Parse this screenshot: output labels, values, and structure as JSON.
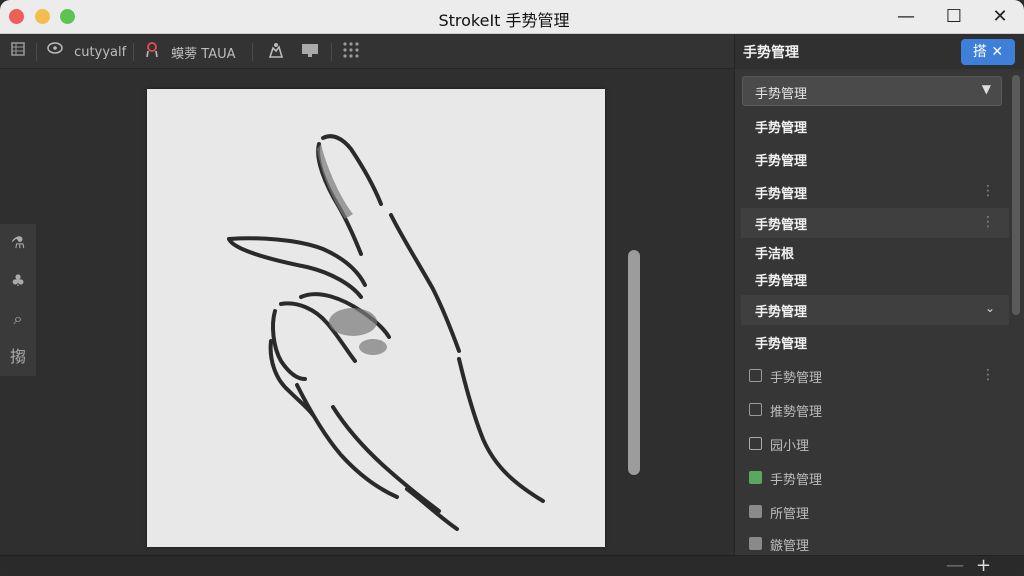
{
  "window": {
    "title": "StrokeIt 手势管理",
    "controls": {
      "minimize": "—",
      "maximize": "☐",
      "close": "✕"
    }
  },
  "toolbar": {
    "item1_label": "cutyyalf",
    "item2_label": "蟆蒡 TAUA"
  },
  "rail": {
    "items": [
      {
        "icon": "flask-icon",
        "glyph": "⚗"
      },
      {
        "icon": "shapes-icon",
        "glyph": "♣"
      },
      {
        "icon": "search-icon",
        "glyph": "⌕"
      },
      {
        "icon": "text-tool-icon",
        "glyph": "搊"
      }
    ]
  },
  "panel": {
    "title": "手势管理",
    "action_label": "搭 ✕",
    "dropdown_value": "手势管理",
    "items": [
      {
        "label": "手势管理"
      },
      {
        "label": "手势管理"
      },
      {
        "label": "手势管理"
      },
      {
        "label": "手势管理"
      },
      {
        "label": "手洁根"
      },
      {
        "label": "手势管理"
      },
      {
        "label": "手势管理"
      },
      {
        "label": "手势管理"
      }
    ],
    "check_items": [
      {
        "label": "手勢管理"
      },
      {
        "label": "推勢管理"
      },
      {
        "label": "园小理"
      },
      {
        "label": "手势管理"
      },
      {
        "label": "所管理"
      },
      {
        "label": "鏃管理"
      }
    ]
  },
  "bottombar": {
    "minus": "—",
    "plus": "+"
  }
}
